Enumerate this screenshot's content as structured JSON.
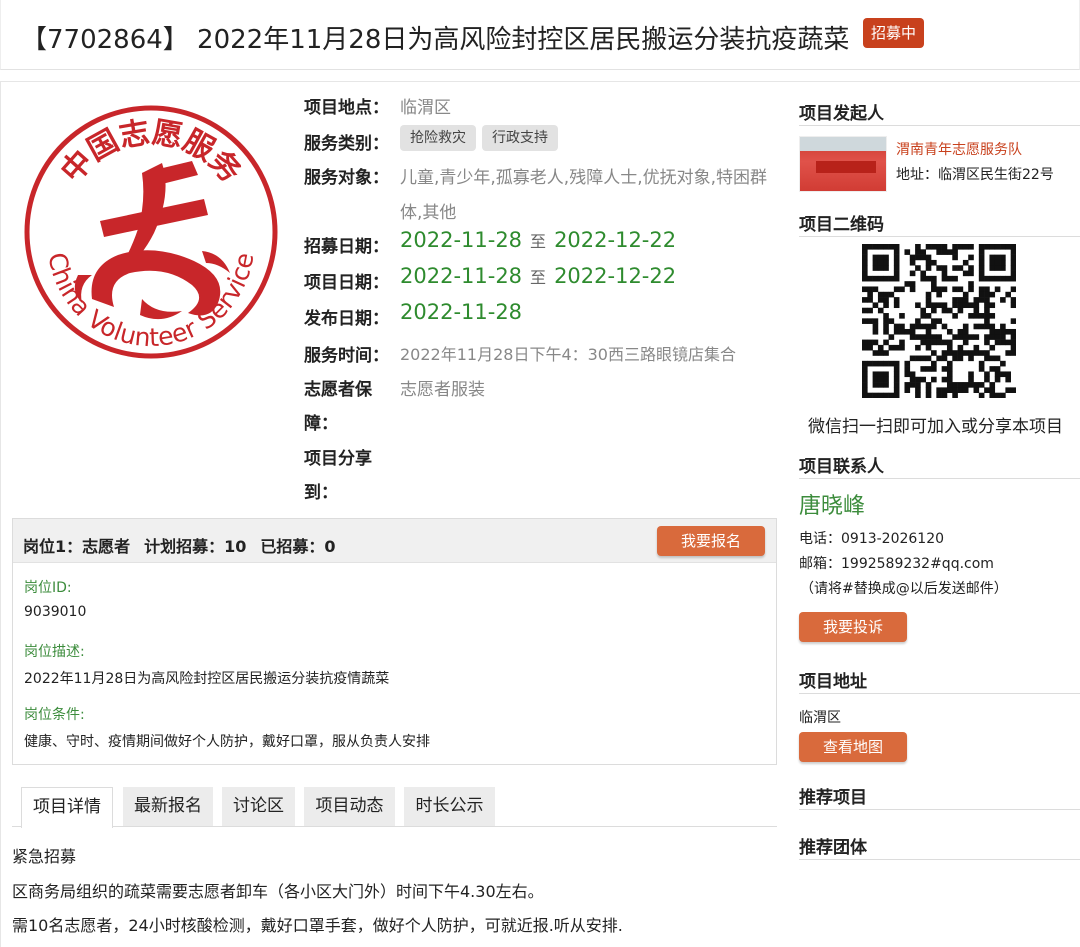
{
  "header": {
    "title": "【7702864】 2022年11月28日为高风险封控区居民搬运分装抗疫蔬菜",
    "status_badge": "招募中"
  },
  "logo": {
    "text_top": "中国志愿服务",
    "text_bottom": "China Volunteer Service",
    "glyph": "志"
  },
  "info": {
    "location_label": "项目地点：",
    "location_value": "临渭区",
    "category_label": "服务类别：",
    "categories": [
      "抢险救灾",
      "行政支持"
    ],
    "target_label": "服务对象：",
    "target_value_line1": "儿童,青少年,孤寡老人,残障人士,优抚对象,特困群",
    "target_value_line2": "体,其他",
    "recruit_label": "招募日期：",
    "recruit_start": "2022-11-28",
    "recruit_end": "2022-12-22",
    "project_label": "项目日期：",
    "project_start": "2022-11-28",
    "project_end": "2022-12-22",
    "to_text": "至",
    "publish_label": "发布日期：",
    "publish_date": "2022-11-28",
    "service_time_label": "服务时间：",
    "service_time_value": "2022年11月28日下午4：30西三路眼镜店集合",
    "guarantee_label_line1": "志愿者保",
    "guarantee_label_line2": "障：",
    "guarantee_value": "志愿者服装",
    "share_label_line1": "项目分享",
    "share_label_line2": "到："
  },
  "position": {
    "head_position": "岗位1：志愿者",
    "head_plan": "计划招募：10",
    "head_recruited": "已招募：0",
    "signup_button": "我要报名",
    "id_label": "岗位ID:",
    "id_value": "9039010",
    "desc_label": "岗位描述:",
    "desc_value": "2022年11月28日为高风险封控区居民搬运分装抗疫情蔬菜",
    "cond_label": "岗位条件:",
    "cond_value": "健康、守时、疫情期间做好个人防护，戴好口罩，服从负责人安排"
  },
  "tabs": [
    {
      "label": "项目详情",
      "active": true
    },
    {
      "label": "最新报名",
      "active": false
    },
    {
      "label": "讨论区",
      "active": false
    },
    {
      "label": "项目动态",
      "active": false
    },
    {
      "label": "时长公示",
      "active": false
    }
  ],
  "detail": {
    "line1": "紧急招募",
    "line2": "区商务局组织的疏菜需要志愿者卸车（各小区大门外）时间下午4.30左右。",
    "line3": "需10名志愿者，24小时核酸检测，戴好口罩手套，做好个人防护，可就近报.听从安排."
  },
  "sidebar": {
    "initiator_title": "项目发起人",
    "org_name": "渭南青年志愿服务队",
    "org_address": "地址：临渭区民生街22号",
    "qr_title": "项目二维码",
    "qr_caption": "微信扫一扫即可加入或分享本项目",
    "contact_title": "项目联系人",
    "contact_name": "唐晓峰",
    "phone": "电话：0913-2026120",
    "email": "邮箱：1992589232#qq.com",
    "email_note": "（请将#替换成@以后发送邮件）",
    "complain_button": "我要投诉",
    "address_title": "项目地址",
    "address_value": "临渭区",
    "map_button": "查看地图",
    "recommend_projects": "推荐项目",
    "recommend_teams": "推荐团体"
  },
  "colors": {
    "accent_red": "#c8411d",
    "button_orange": "#d96a3c",
    "date_green": "#2e8b2e",
    "label_green": "#3c8c3c"
  }
}
